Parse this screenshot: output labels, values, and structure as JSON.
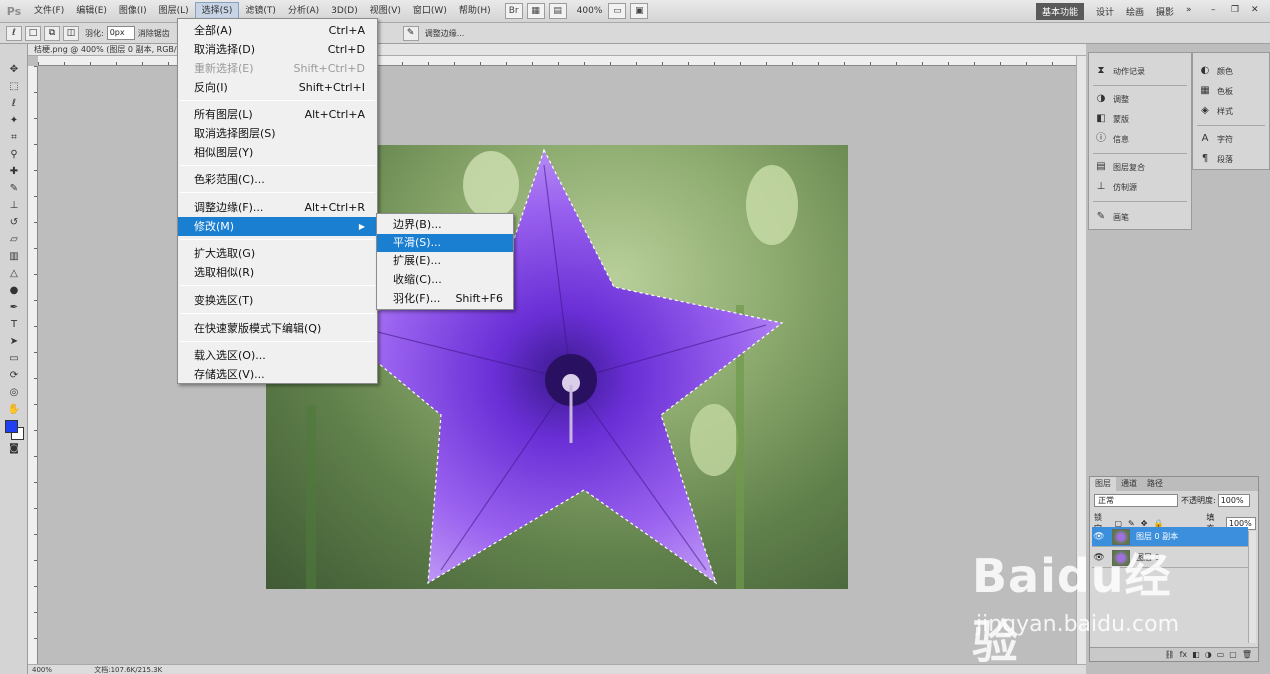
{
  "app": {
    "logo": "Ps"
  },
  "menubar": {
    "items": [
      "文件(F)",
      "编辑(E)",
      "图像(I)",
      "图层(L)",
      "选择(S)",
      "滤镜(T)",
      "分析(A)",
      "3D(D)",
      "视图(V)",
      "窗口(W)",
      "帮助(H)"
    ],
    "zoom": "400%",
    "workspaces": [
      "基本功能",
      "设计",
      "绘画",
      "摄影"
    ]
  },
  "options_bar": {
    "feather_label": "羽化:",
    "feather_value": "0px",
    "antialias_label": "消除锯齿",
    "refine_label": "调整边缘..."
  },
  "document": {
    "tab_title": "桔梗.png @ 400% (图层 0 副本, RGB/8)",
    "status_zoom": "400%",
    "status_doc": "文档:107.6K/215.3K"
  },
  "select_menu": {
    "items": [
      {
        "label": "全部(A)",
        "shortcut": "Ctrl+A"
      },
      {
        "label": "取消选择(D)",
        "shortcut": "Ctrl+D"
      },
      {
        "label": "重新选择(E)",
        "shortcut": "Shift+Ctrl+D"
      },
      {
        "label": "反向(I)",
        "shortcut": "Shift+Ctrl+I"
      },
      {
        "label": "所有图层(L)",
        "shortcut": "Alt+Ctrl+A"
      },
      {
        "label": "取消选择图层(S)",
        "shortcut": ""
      },
      {
        "label": "相似图层(Y)",
        "shortcut": ""
      },
      {
        "label": "色彩范围(C)...",
        "shortcut": ""
      },
      {
        "label": "调整边缘(F)...",
        "shortcut": "Alt+Ctrl+R"
      },
      {
        "label": "修改(M)",
        "shortcut": ""
      },
      {
        "label": "扩大选取(G)",
        "shortcut": ""
      },
      {
        "label": "选取相似(R)",
        "shortcut": ""
      },
      {
        "label": "变换选区(T)",
        "shortcut": ""
      },
      {
        "label": "在快速蒙版模式下编辑(Q)",
        "shortcut": ""
      },
      {
        "label": "载入选区(O)...",
        "shortcut": ""
      },
      {
        "label": "存储选区(V)...",
        "shortcut": ""
      }
    ]
  },
  "modify_menu": {
    "items": [
      {
        "label": "边界(B)...",
        "shortcut": ""
      },
      {
        "label": "平滑(S)...",
        "shortcut": ""
      },
      {
        "label": "扩展(E)...",
        "shortcut": ""
      },
      {
        "label": "收缩(C)...",
        "shortcut": ""
      },
      {
        "label": "羽化(F)...",
        "shortcut": "Shift+F6"
      }
    ]
  },
  "panels": {
    "dock1": [
      "动作记录",
      "调整",
      "蒙版",
      "信息",
      "图层复合",
      "仿制源",
      "画笔"
    ],
    "dock2": [
      "颜色",
      "色板",
      "样式",
      "字符",
      "段落"
    ]
  },
  "layers_panel": {
    "tabs": [
      "图层",
      "通道",
      "路径"
    ],
    "blend_mode": "正常",
    "opacity_label": "不透明度:",
    "opacity": "100%",
    "lock_label": "锁定:",
    "fill_label": "填充:",
    "fill": "100%",
    "layers": [
      {
        "name": "图层 0 副本",
        "selected": true
      },
      {
        "name": "图层 0",
        "selected": false
      }
    ]
  },
  "watermark": {
    "brand": "Baidu经验",
    "url": "jingyan.baidu.com"
  }
}
